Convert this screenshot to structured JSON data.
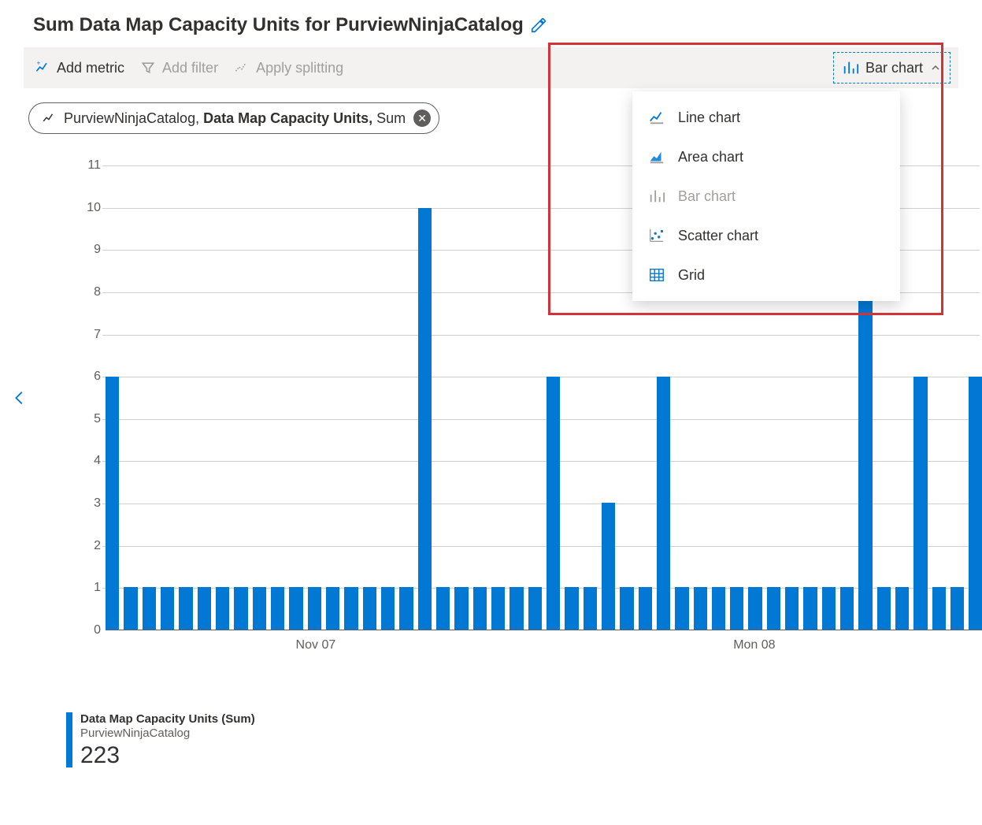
{
  "title": "Sum Data Map Capacity Units for PurviewNinjaCatalog",
  "toolbar": {
    "add_metric": "Add metric",
    "add_filter": "Add filter",
    "apply_splitting": "Apply splitting",
    "chart_type_label": "Bar chart"
  },
  "dropdown_items": [
    {
      "icon": "line-chart-icon",
      "label": "Line chart",
      "disabled": false
    },
    {
      "icon": "area-chart-icon",
      "label": "Area chart",
      "disabled": false
    },
    {
      "icon": "bar-chart-icon",
      "label": "Bar chart",
      "disabled": true
    },
    {
      "icon": "scatter-chart-icon",
      "label": "Scatter chart",
      "disabled": false
    },
    {
      "icon": "grid-icon",
      "label": "Grid",
      "disabled": false
    }
  ],
  "chip": {
    "resource": "PurviewNinjaCatalog, ",
    "metric": "Data Map Capacity Units,",
    "agg": " Sum"
  },
  "legend": {
    "line1": "Data Map Capacity Units (Sum)",
    "line2": "PurviewNinjaCatalog",
    "value": "223"
  },
  "colors": {
    "accent": "#0078d4",
    "highlight_border": "#d13438"
  },
  "chart_data": {
    "type": "bar",
    "title": "Sum Data Map Capacity Units for PurviewNinjaCatalog",
    "xlabel": "",
    "ylabel": "",
    "ylim": [
      0,
      11
    ],
    "y_ticks": [
      0,
      1,
      2,
      3,
      4,
      5,
      6,
      7,
      8,
      9,
      10,
      11
    ],
    "x_tick_labels": [
      {
        "pos_index": 11,
        "label": "Nov 07"
      },
      {
        "pos_index": 35,
        "label": "Mon 08"
      }
    ],
    "values": [
      6,
      1,
      1,
      1,
      1,
      1,
      1,
      1,
      1,
      1,
      1,
      1,
      1,
      1,
      1,
      1,
      1,
      10,
      1,
      1,
      1,
      1,
      1,
      1,
      6,
      1,
      1,
      3,
      1,
      1,
      6,
      1,
      1,
      1,
      1,
      1,
      1,
      1,
      1,
      1,
      1,
      9,
      1,
      1,
      6,
      1,
      1,
      6
    ],
    "total_sum": 223
  }
}
